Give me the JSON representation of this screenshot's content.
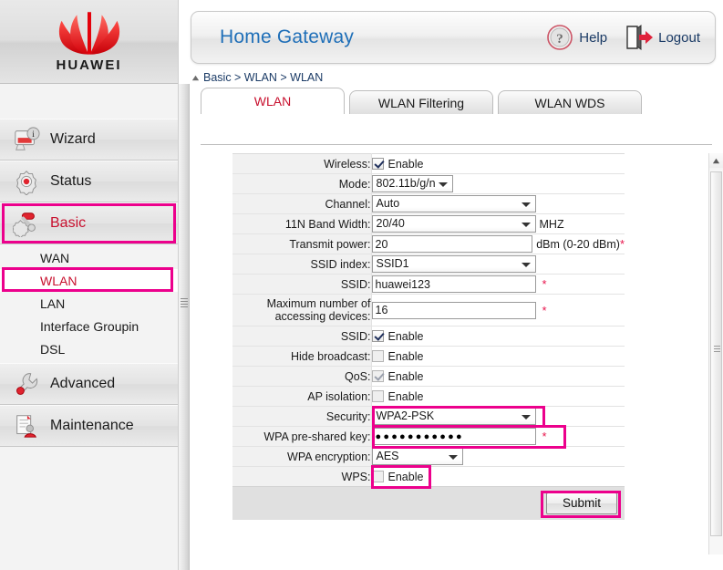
{
  "brand": {
    "wordmark": "HUAWEI",
    "logo_color": "#e4010b",
    "accent_highlight": "#ec008c",
    "selected_text_color": "#c8102e"
  },
  "header": {
    "title": "Home Gateway",
    "title_color": "#1f6fb8",
    "help_label": "Help",
    "help_icon": "question-circle-icon",
    "logout_label": "Logout",
    "logout_icon": "door-exit-arrow-icon"
  },
  "breadcrumb": {
    "collapse_icon": "triangle-up-icon",
    "text": "Basic > WLAN > WLAN"
  },
  "sidebar": {
    "main_items": [
      {
        "label": "Wizard",
        "icon": "monitor-info-icon",
        "selected": false
      },
      {
        "label": "Status",
        "icon": "gear-status-icon",
        "selected": false
      },
      {
        "label": "Basic",
        "icon": "gear-tools-icon",
        "selected": true
      },
      {
        "label": "Advanced",
        "icon": "wrench-icon",
        "selected": false
      },
      {
        "label": "Maintenance",
        "icon": "document-user-icon",
        "selected": false
      }
    ],
    "sub_items": [
      {
        "label": "WAN",
        "selected": false
      },
      {
        "label": "WLAN",
        "selected": true
      },
      {
        "label": "LAN",
        "selected": false
      },
      {
        "label": "Interface Groupin",
        "selected": false
      },
      {
        "label": "DSL",
        "selected": false
      }
    ]
  },
  "tabs": [
    {
      "label": "WLAN",
      "active": true
    },
    {
      "label": "WLAN Filtering",
      "active": false
    },
    {
      "label": "WLAN WDS",
      "active": false
    }
  ],
  "form": {
    "wireless": {
      "label": "Wireless:",
      "checkbox_label": "Enable",
      "checked": true
    },
    "mode": {
      "label": "Mode:",
      "value": "802.11b/g/n"
    },
    "channel": {
      "label": "Channel:",
      "value": "Auto"
    },
    "band_width": {
      "label": "11N Band Width:",
      "value": "20/40",
      "suffix": "MHZ"
    },
    "transmit_power": {
      "label": "Transmit power:",
      "value": "20",
      "suffix": "dBm (0-20 dBm)",
      "required": "*"
    },
    "ssid_index": {
      "label": "SSID index:",
      "value": "SSID1"
    },
    "ssid": {
      "label": "SSID:",
      "value": "huawei123",
      "required": "*"
    },
    "max_devices": {
      "label": "Maximum number of accessing devices:",
      "value": "16",
      "required": "*"
    },
    "ssid_enable": {
      "label": "SSID:",
      "checkbox_label": "Enable",
      "checked": true
    },
    "hide_broadcast": {
      "label": "Hide broadcast:",
      "checkbox_label": "Enable",
      "checked": false
    },
    "qos": {
      "label": "QoS:",
      "checkbox_label": "Enable",
      "checked": true
    },
    "ap_isolation": {
      "label": "AP isolation:",
      "checkbox_label": "Enable",
      "checked": false
    },
    "security": {
      "label": "Security:",
      "value": "WPA2-PSK"
    },
    "wpa_key": {
      "label": "WPA pre-shared key:",
      "value": "●●●●●●●●●●●",
      "required": "*"
    },
    "wpa_encryption": {
      "label": "WPA encryption:",
      "value": "AES"
    },
    "wps": {
      "label": "WPS:",
      "checkbox_label": "Enable",
      "checked": false
    },
    "submit": {
      "label": "Submit"
    }
  },
  "scrollbar": {
    "up_icon": "triangle-up-icon",
    "grip_icon": "grip-lines-icon"
  }
}
